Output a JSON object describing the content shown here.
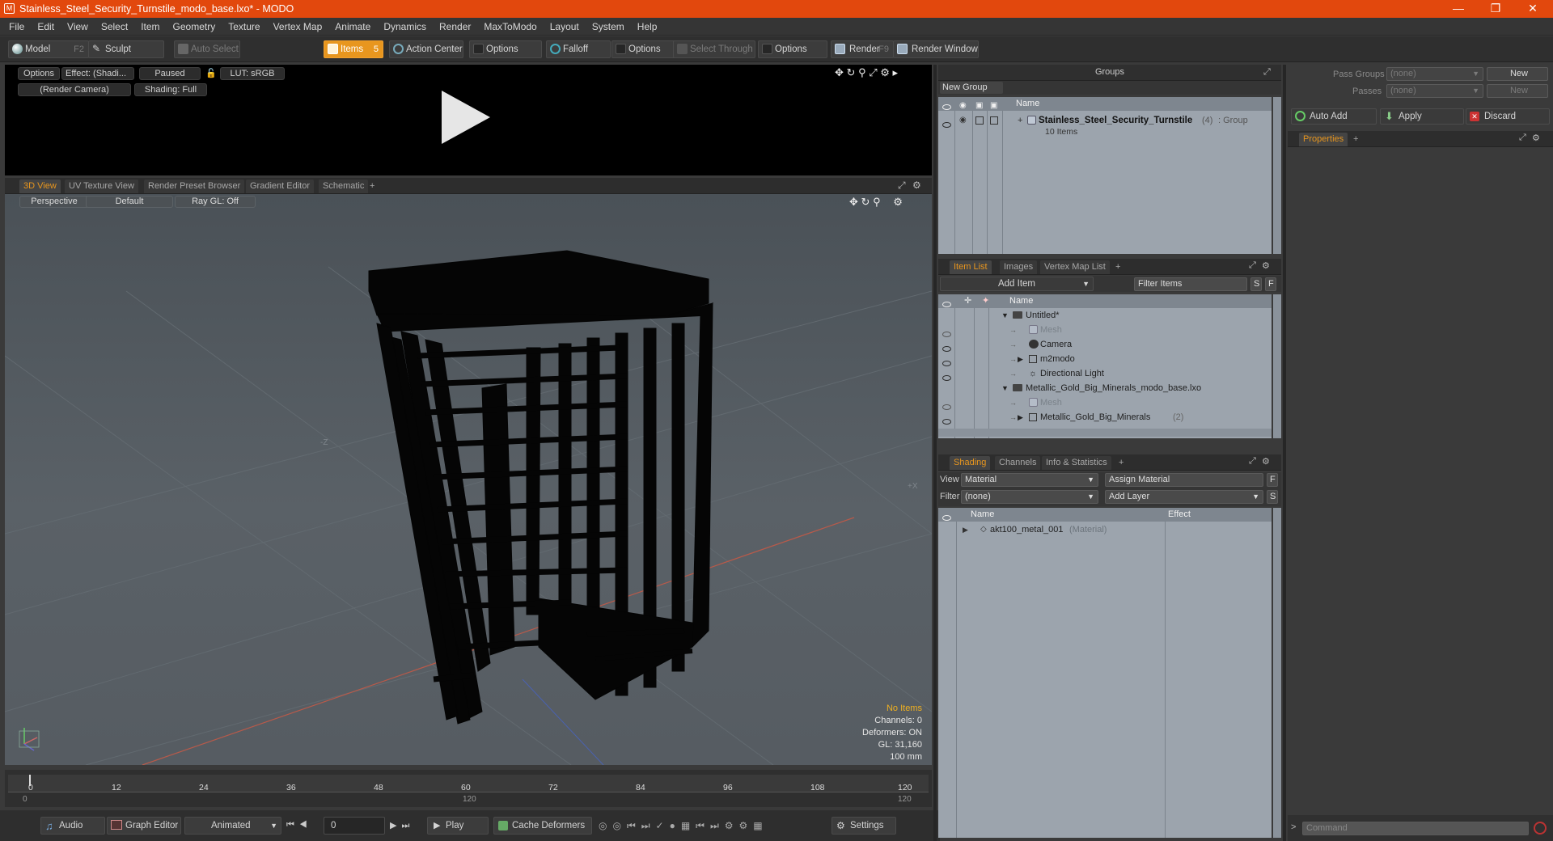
{
  "window": {
    "title": "Stainless_Steel_Security_Turnstile_modo_base.lxo* - MODO",
    "app_icon": "modo-icon"
  },
  "menu": [
    "File",
    "Edit",
    "View",
    "Select",
    "Item",
    "Geometry",
    "Texture",
    "Vertex Map",
    "Animate",
    "Dynamics",
    "Render",
    "MaxToModo",
    "Layout",
    "System",
    "Help"
  ],
  "toolbar": {
    "model": "Model",
    "model_key": "F2",
    "sculpt": "Sculpt",
    "auto_select": "Auto Select",
    "items": "Items",
    "items_key": "5",
    "action_center": "Action Center",
    "options1": "Options",
    "falloff": "Falloff",
    "options2": "Options",
    "select_through": "Select Through",
    "options3": "Options",
    "render": "Render",
    "render_key": "F9",
    "render_window": "Render Window"
  },
  "preview": {
    "options": "Options",
    "effect": "Effect: (Shadi...",
    "paused": "Paused",
    "lut": "LUT: sRGB",
    "camera": "(Render Camera)",
    "shading": "Shading: Full"
  },
  "viewport_tabs": [
    "3D View",
    "UV Texture View",
    "Render Preset Browser",
    "Gradient Editor",
    "Schematic",
    "+"
  ],
  "viewport": {
    "perspective": "Perspective",
    "default": "Default",
    "raygl": "Ray GL: Off",
    "axis_neg_z": "-Z",
    "axis_pos_x": "+X",
    "hud": {
      "no_items": "No Items",
      "channels": "Channels: 0",
      "deformers": "Deformers: ON",
      "gl": "GL: 31,160",
      "scale": "100 mm"
    }
  },
  "timeline": {
    "ticks": [
      "0",
      "12",
      "24",
      "36",
      "48",
      "60",
      "72",
      "84",
      "96",
      "108",
      "120"
    ],
    "start": "0",
    "end_mid": "120",
    "end": "120"
  },
  "bottom": {
    "audio": "Audio",
    "graph_editor": "Graph Editor",
    "animated": "Animated",
    "frame": "0",
    "play": "Play",
    "cache_deformers": "Cache Deformers",
    "settings": "Settings"
  },
  "groups": {
    "title": "Groups",
    "new_group": "New Group",
    "col_name": "Name",
    "item_name": "Stainless_Steel_Security_Turnstile",
    "item_count": "(4)",
    "item_type": ": Group",
    "item_sub": "10 Items"
  },
  "item_list": {
    "tabs": [
      "Item List",
      "Images",
      "Vertex Map List",
      "+"
    ],
    "add_item": "Add Item",
    "filter": "Filter Items",
    "s": "S",
    "f": "F",
    "col_name": "Name",
    "rows": [
      {
        "label": "Untitled*",
        "indent": 0,
        "dim": false
      },
      {
        "label": "Mesh",
        "indent": 1,
        "dim": true
      },
      {
        "label": "Camera",
        "indent": 1,
        "dim": false
      },
      {
        "label": "m2modo",
        "indent": 1,
        "dim": false
      },
      {
        "label": "Directional Light",
        "indent": 1,
        "dim": false
      },
      {
        "label": "Metallic_Gold_Big_Minerals_modo_base.lxo",
        "indent": 0,
        "dim": false
      },
      {
        "label": "Mesh",
        "indent": 1,
        "dim": true
      },
      {
        "label": "Metallic_Gold_Big_Minerals",
        "indent": 1,
        "dim": false,
        "suffix": "(2)"
      }
    ]
  },
  "shading": {
    "tabs": [
      "Shading",
      "Channels",
      "Info & Statistics",
      "+"
    ],
    "view_label": "View",
    "view_value": "Material",
    "assign_material": "Assign Material",
    "f": "F",
    "filter_label": "Filter",
    "filter_value": "(none)",
    "add_layer": "Add Layer",
    "s": "S",
    "col_name": "Name",
    "col_effect": "Effect",
    "row_name": "akt100_metal_001",
    "row_type": "(Material)"
  },
  "properties": {
    "pass_groups": "Pass Groups",
    "passes": "Passes",
    "none": "(none)",
    "new": "New",
    "auto_add": "Auto Add",
    "apply": "Apply",
    "discard": "Discard",
    "tab": "Properties",
    "plus": "+",
    "command": "Command"
  }
}
